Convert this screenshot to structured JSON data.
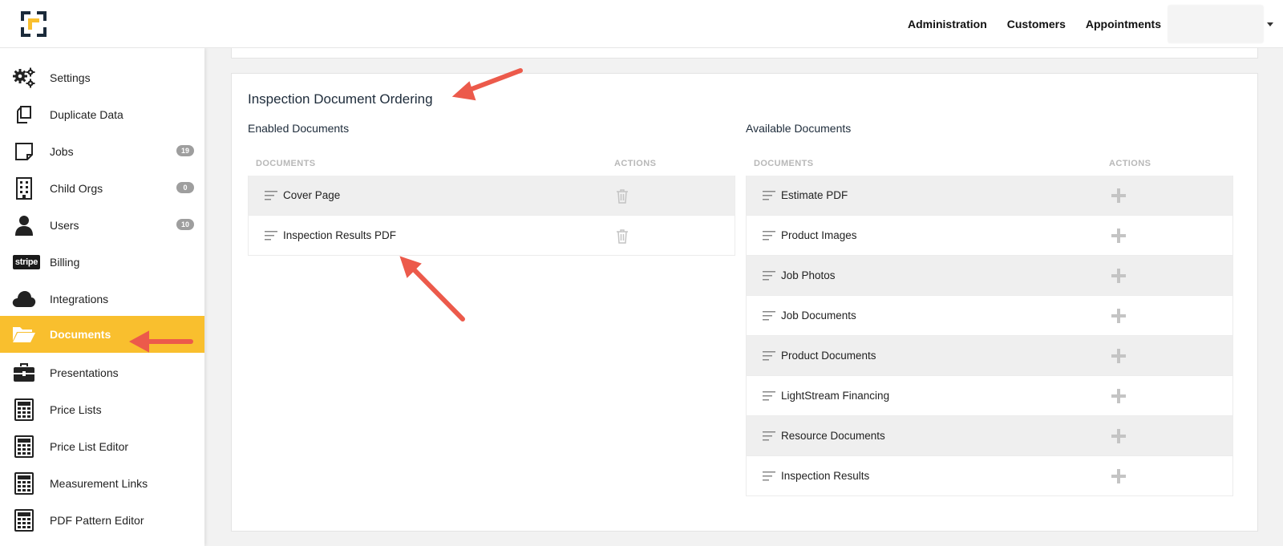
{
  "header": {
    "nav": [
      "Administration",
      "Customers",
      "Appointments"
    ]
  },
  "sidebar": {
    "items": [
      {
        "label": "Settings",
        "icon": "gears-icon",
        "badge": ""
      },
      {
        "label": "Duplicate Data",
        "icon": "duplicate-icon",
        "badge": ""
      },
      {
        "label": "Jobs",
        "icon": "note-icon",
        "badge": "19"
      },
      {
        "label": "Child Orgs",
        "icon": "building-icon",
        "badge": "0"
      },
      {
        "label": "Users",
        "icon": "user-icon",
        "badge": "10"
      },
      {
        "label": "Billing",
        "icon": "stripe-icon",
        "badge": ""
      },
      {
        "label": "Integrations",
        "icon": "cloud-icon",
        "badge": ""
      },
      {
        "label": "Documents",
        "icon": "folder-open-icon",
        "badge": "",
        "active": true
      },
      {
        "label": "Presentations",
        "icon": "briefcase-icon",
        "badge": ""
      },
      {
        "label": "Price Lists",
        "icon": "calculator-icon",
        "badge": ""
      },
      {
        "label": "Price List Editor",
        "icon": "calculator-icon",
        "badge": ""
      },
      {
        "label": "Measurement Links",
        "icon": "calculator-icon",
        "badge": ""
      },
      {
        "label": "PDF Pattern Editor",
        "icon": "calculator-icon",
        "badge": ""
      }
    ],
    "stripe_text": "stripe"
  },
  "main": {
    "title": "Inspection Document Ordering",
    "enabled": {
      "title": "Enabled Documents",
      "col_documents": "DOCUMENTS",
      "col_actions": "ACTIONS",
      "rows": [
        "Cover Page",
        "Inspection Results PDF"
      ]
    },
    "available": {
      "title": "Available Documents",
      "col_documents": "DOCUMENTS",
      "col_actions": "ACTIONS",
      "rows": [
        "Estimate PDF",
        "Product Images",
        "Job Photos",
        "Job Documents",
        "Product Documents",
        "LightStream Financing",
        "Resource Documents",
        "Inspection Results"
      ]
    }
  },
  "colors": {
    "accent": "#f9bf2e",
    "annotation_arrow": "#ec5a4b",
    "text_dark": "#1d2b3a"
  }
}
